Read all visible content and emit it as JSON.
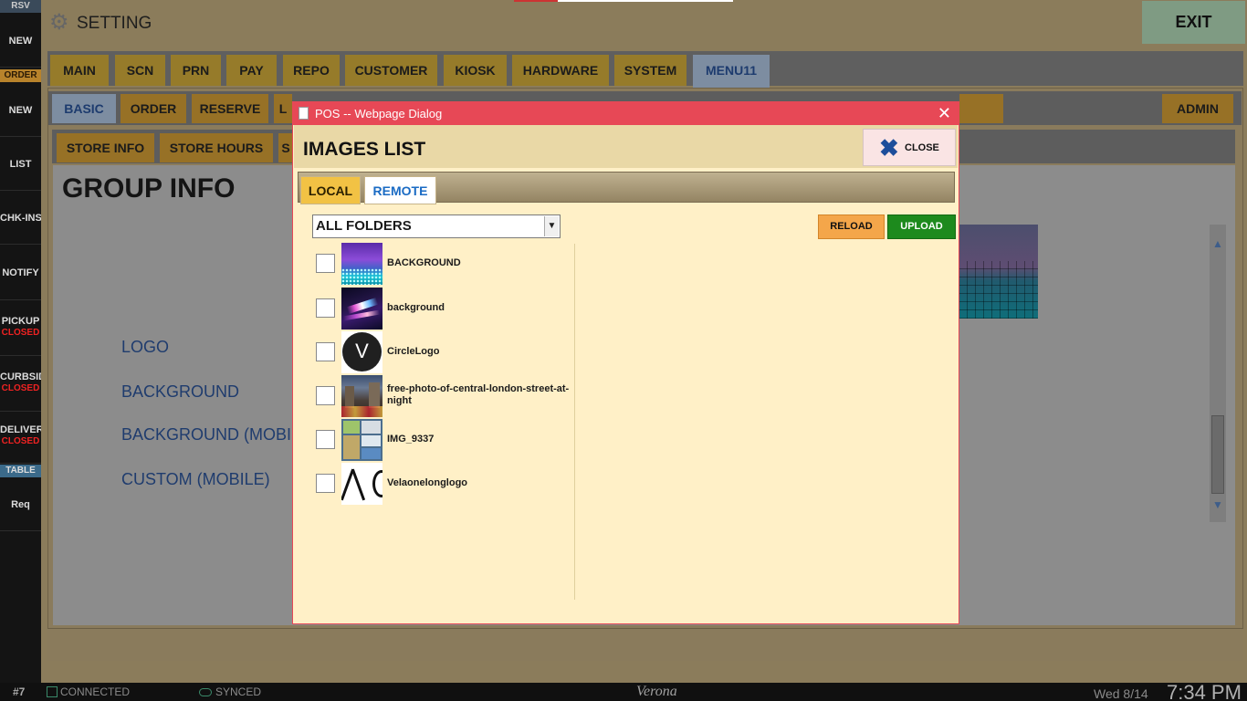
{
  "left_rail": {
    "items": [
      {
        "label": "RSV",
        "style": "tag-gray"
      },
      {
        "label": "NEW"
      },
      {
        "label": "ORDER",
        "style": "tag-orange"
      },
      {
        "label": "NEW"
      },
      {
        "label": "LIST"
      },
      {
        "label": "CHK-INS"
      },
      {
        "label": "NOTIFY"
      },
      {
        "label": "PICKUP",
        "sub": "CLOSED"
      },
      {
        "label": "CURBSIDE",
        "sub": "CLOSED"
      },
      {
        "label": "DELIVERY",
        "sub": "CLOSED"
      },
      {
        "label": "TABLE",
        "style": "tag-blue"
      },
      {
        "label": "Req"
      }
    ]
  },
  "header": {
    "title": "SETTING",
    "gear_icon": "gear-icon",
    "exit_label": "EXIT"
  },
  "main_tabs": [
    "MAIN",
    "SCN",
    "PRN",
    "PAY",
    "REPO",
    "CUSTOMER",
    "KIOSK",
    "HARDWARE",
    "SYSTEM",
    "MENU11"
  ],
  "main_tab_active": "MENU11",
  "sub_tabs": [
    "BASIC",
    "ORDER",
    "RESERVE",
    "L"
  ],
  "sub_tab_active": "BASIC",
  "admin_label": "ADMIN",
  "subsub_tabs": [
    "STORE INFO",
    "STORE HOURS",
    "S"
  ],
  "page": {
    "title": "GROUP INFO",
    "fields": [
      "LOGO",
      "BACKGROUND",
      "BACKGROUND (MOBILE)",
      "CUSTOM (MOBILE)"
    ]
  },
  "dialog": {
    "title": "POS -- Webpage Dialog",
    "header": "IMAGES LIST",
    "close_label": "CLOSE",
    "tabs": [
      "LOCAL",
      "REMOTE"
    ],
    "active_tab": "LOCAL",
    "folder_select": "ALL FOLDERS",
    "reload_label": "RELOAD",
    "upload_label": "UPLOAD",
    "images": [
      {
        "name": "BACKGROUND",
        "thumb": "purple-sky-teal-grid"
      },
      {
        "name": "background",
        "thumb": "dark-space-lights"
      },
      {
        "name": "CircleLogo",
        "thumb": "black-circle-v"
      },
      {
        "name": "free-photo-of-central-london-street-at-night",
        "thumb": "city-street-night"
      },
      {
        "name": "IMG_9337",
        "thumb": "screenshot-collage"
      },
      {
        "name": "Velaonelonglogo",
        "thumb": "white-logo-lines"
      }
    ]
  },
  "status_bar": {
    "terminal": "#7",
    "connection": "CONNECTED",
    "sync": "SYNCED",
    "store": "Verona",
    "date": "Wed 8/14",
    "time": "7:34 PM"
  },
  "colors": {
    "dialog_accent": "#e74856",
    "dialog_bg": "#fff0c7",
    "tab_gold": "#977126",
    "tab_active": "#7d8da1",
    "upload_green": "#1d8a1d",
    "reload_orange": "#f4a64a",
    "closed_red": "#e22222"
  }
}
